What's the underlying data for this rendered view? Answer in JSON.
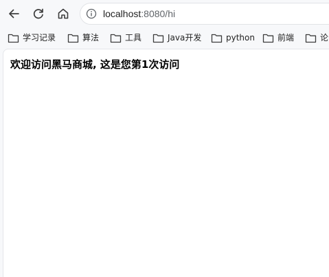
{
  "address_bar": {
    "url_host": "localhost",
    "url_rest": ":8080/hi"
  },
  "bookmarks": [
    {
      "label": "学习记录"
    },
    {
      "label": "算法"
    },
    {
      "label": "工具"
    },
    {
      "label": "Java开发"
    },
    {
      "label": "python"
    },
    {
      "label": "前端"
    },
    {
      "label": "论"
    }
  ],
  "page": {
    "message": "欢迎访问黑马商城, 这是您第1次访问"
  },
  "colors": {
    "chrome_bg": "#f7f8fa",
    "page_bg": "#ffffff",
    "text": "#1f1f1f",
    "muted": "#5f6368"
  }
}
